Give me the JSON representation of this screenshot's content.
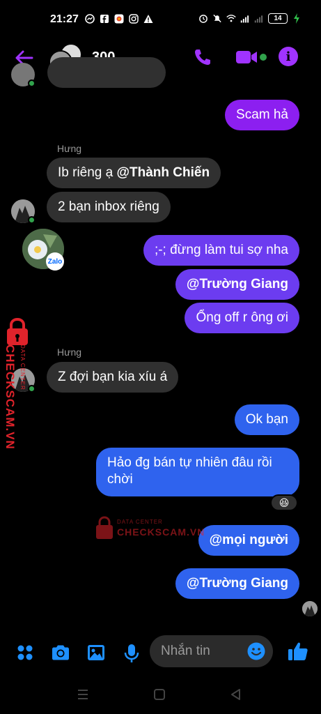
{
  "status": {
    "time": "21:27",
    "battery": "14"
  },
  "header": {
    "title": "300"
  },
  "messages": {
    "m1": "Scam hả",
    "sender1": "Hưng",
    "m2_prefix": "Ib riêng ạ ",
    "m2_mention": "@Thành Chiến",
    "m3": "2 bạn inbox riêng",
    "m4": ";-; đừng làm tui sợ nha",
    "m5": "@Trường Giang",
    "m6": "Ổng off r ông ơi",
    "sender2": "Hưng",
    "m7": "Z đợi bạn kia xíu á",
    "m8": "Ok bạn",
    "m9_line1": "Hảo đg bán tự nhiên đâu rồi",
    "m9_line2": "chời",
    "reaction": "😆",
    "m10": "@mọi người",
    "m11": "@Trường Giang"
  },
  "zalo_badge": "Zalo",
  "watermark": {
    "small": "DATA CENTER",
    "big": "CHECKSCAM.VN"
  },
  "input": {
    "placeholder": "Nhắn tin"
  },
  "colors": {
    "accent": "#a033ff",
    "blue": "#2f63ee",
    "incoming": "#303030",
    "icons": "#1e90ff"
  }
}
